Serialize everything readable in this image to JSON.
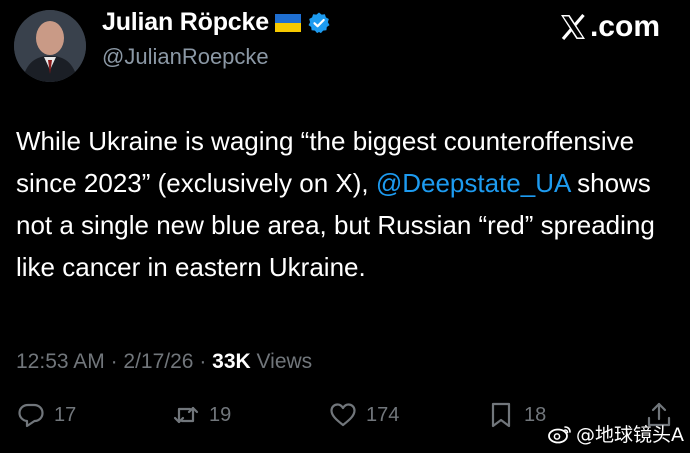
{
  "author": {
    "display_name": "Julian Röpcke",
    "handle": "@JulianRoepcke",
    "flag": "ukraine-flag-icon",
    "verified": true
  },
  "source_label": ".com",
  "tweet": {
    "text_before": "While Ukraine is waging “the biggest counteroffensive since 2023” (exclusively on X), ",
    "mention": "@Deepstate_UA",
    "text_after": " shows not a single new blue area, but Russian “red” spreading like cancer in eastern Ukraine."
  },
  "meta": {
    "time": "12:53 AM",
    "separator": " · ",
    "date": "2/17/26",
    "views_count": "33K",
    "views_label": " Views"
  },
  "actions": {
    "replies": "17",
    "reposts": "19",
    "likes": "174",
    "bookmarks": "18"
  },
  "watermark": "@地球镜头A",
  "colors": {
    "background": "#000000",
    "text": "#ffffff",
    "muted": "#71767b",
    "link": "#1d9bf0",
    "verified": "#1d9bf0"
  }
}
